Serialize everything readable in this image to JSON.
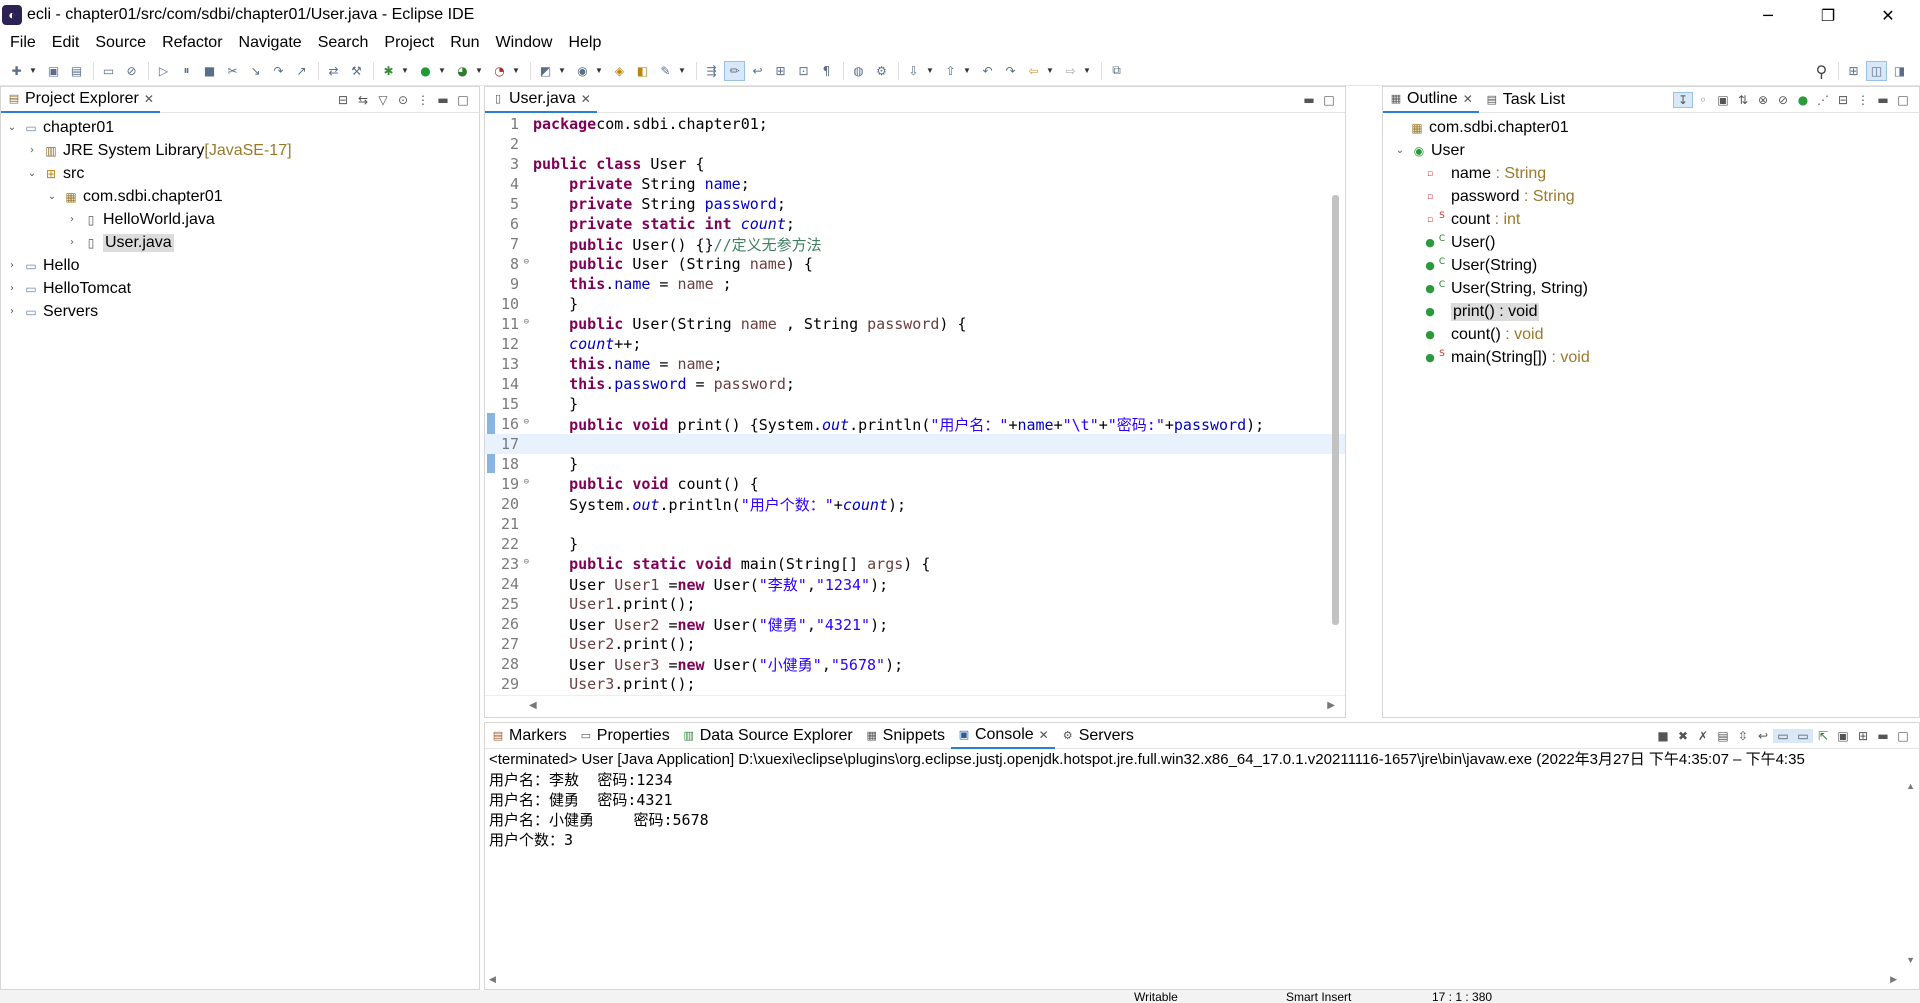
{
  "window": {
    "title": "ecli - chapter01/src/com/sdbi/chapter01/User.java - Eclipse IDE",
    "minimize": "─",
    "maximize": "❐",
    "close": "✕"
  },
  "menu": [
    "File",
    "Edit",
    "Source",
    "Refactor",
    "Navigate",
    "Search",
    "Project",
    "Run",
    "Window",
    "Help"
  ],
  "project_explorer": {
    "tab": "Project Explorer",
    "items": [
      {
        "label": "chapter01",
        "icon": "project-icon",
        "indent": 0,
        "expanded": true
      },
      {
        "label": "JRE System Library",
        "decor": " [JavaSE-17]",
        "icon": "library-icon",
        "indent": 1,
        "expanded": false
      },
      {
        "label": "src",
        "icon": "package-folder-icon",
        "indent": 1,
        "expanded": true
      },
      {
        "label": "com.sdbi.chapter01",
        "icon": "package-icon",
        "indent": 2,
        "expanded": true
      },
      {
        "label": "HelloWorld.java",
        "icon": "java-file-icon",
        "indent": 3,
        "expanded": false
      },
      {
        "label": "User.java",
        "icon": "java-file-icon",
        "indent": 3,
        "expanded": false,
        "selected": true
      },
      {
        "label": "Hello",
        "icon": "project-icon",
        "indent": 0,
        "expanded": false
      },
      {
        "label": "HelloTomcat",
        "icon": "project-icon",
        "indent": 0,
        "expanded": false
      },
      {
        "label": "Servers",
        "icon": "project-icon",
        "indent": 0,
        "expanded": false
      }
    ]
  },
  "editor": {
    "tab": "User.java",
    "current_line": 17,
    "lines": [
      {
        "n": "1",
        "t": [
          [
            "kw",
            "package"
          ],
          [
            "",
            "com.sdbi.chapter01;"
          ]
        ]
      },
      {
        "n": "2",
        "t": []
      },
      {
        "n": "3",
        "t": [
          [
            "kw",
            "public class"
          ],
          [
            "",
            " User {"
          ]
        ]
      },
      {
        "n": "4",
        "t": [
          [
            "",
            "    "
          ],
          [
            "kw",
            "private"
          ],
          [
            "",
            " String "
          ],
          [
            "fld",
            "name"
          ],
          [
            "",
            ";"
          ]
        ]
      },
      {
        "n": "5",
        "t": [
          [
            "",
            "    "
          ],
          [
            "kw",
            "private"
          ],
          [
            "",
            " String "
          ],
          [
            "fld",
            "password"
          ],
          [
            "",
            ";"
          ]
        ]
      },
      {
        "n": "6",
        "t": [
          [
            "",
            "    "
          ],
          [
            "kw",
            "private static int"
          ],
          [
            "",
            " "
          ],
          [
            "sf",
            "count"
          ],
          [
            "",
            ";"
          ]
        ]
      },
      {
        "n": "7",
        "t": [
          [
            "",
            "    "
          ],
          [
            "kw",
            "public"
          ],
          [
            "",
            " User() {}"
          ],
          [
            "cmt",
            "//定义无参方法"
          ]
        ]
      },
      {
        "n": "8",
        "fold": true,
        "t": [
          [
            "",
            "    "
          ],
          [
            "kw",
            "public"
          ],
          [
            "",
            " User (String "
          ],
          [
            "var",
            "name"
          ],
          [
            "",
            ") {"
          ]
        ]
      },
      {
        "n": "9",
        "t": [
          [
            "",
            "    "
          ],
          [
            "kw",
            "this"
          ],
          [
            "",
            "."
          ],
          [
            "fld",
            "name"
          ],
          [
            "",
            " = "
          ],
          [
            "var",
            "name"
          ],
          [
            "",
            " ;"
          ]
        ]
      },
      {
        "n": "10",
        "t": [
          [
            "",
            "    }"
          ]
        ]
      },
      {
        "n": "11",
        "fold": true,
        "t": [
          [
            "",
            "    "
          ],
          [
            "kw",
            "public"
          ],
          [
            "",
            " User(String "
          ],
          [
            "var",
            "name"
          ],
          [
            "",
            " , String "
          ],
          [
            "var",
            "password"
          ],
          [
            "",
            ") {"
          ]
        ]
      },
      {
        "n": "12",
        "t": [
          [
            "",
            "    "
          ],
          [
            "sf",
            "count"
          ],
          [
            "",
            "++;"
          ]
        ]
      },
      {
        "n": "13",
        "t": [
          [
            "",
            "    "
          ],
          [
            "kw",
            "this"
          ],
          [
            "",
            "."
          ],
          [
            "fld",
            "name"
          ],
          [
            "",
            " = "
          ],
          [
            "var",
            "name"
          ],
          [
            "",
            ";"
          ]
        ]
      },
      {
        "n": "14",
        "t": [
          [
            "",
            "    "
          ],
          [
            "kw",
            "this"
          ],
          [
            "",
            "."
          ],
          [
            "fld",
            "password"
          ],
          [
            "",
            " = "
          ],
          [
            "var",
            "password"
          ],
          [
            "",
            ";"
          ]
        ]
      },
      {
        "n": "15",
        "t": [
          [
            "",
            "    }"
          ]
        ]
      },
      {
        "n": "16",
        "fold": true,
        "t": [
          [
            "",
            "    "
          ],
          [
            "kw",
            "public void"
          ],
          [
            "",
            " print() {System."
          ],
          [
            "sf",
            "out"
          ],
          [
            "",
            ".println("
          ],
          [
            "str",
            "\"用户名：\""
          ],
          [
            "",
            "+"
          ],
          [
            "fld",
            "name"
          ],
          [
            "",
            "+"
          ],
          [
            "str",
            "\"\\t\""
          ],
          [
            "",
            "+"
          ],
          [
            "str",
            "\"密码:\""
          ],
          [
            "",
            "+"
          ],
          [
            "fld",
            "password"
          ],
          [
            "",
            ");"
          ]
        ]
      },
      {
        "n": "17",
        "t": []
      },
      {
        "n": "18",
        "t": [
          [
            "",
            "    }"
          ]
        ]
      },
      {
        "n": "19",
        "fold": true,
        "t": [
          [
            "",
            "    "
          ],
          [
            "kw",
            "public void"
          ],
          [
            "",
            " count() {"
          ]
        ]
      },
      {
        "n": "20",
        "t": [
          [
            "",
            "    System."
          ],
          [
            "sf",
            "out"
          ],
          [
            "",
            ".println("
          ],
          [
            "str",
            "\"用户个数：\""
          ],
          [
            "",
            "+"
          ],
          [
            "sf",
            "count"
          ],
          [
            "",
            ");"
          ]
        ]
      },
      {
        "n": "21",
        "t": []
      },
      {
        "n": "22",
        "t": [
          [
            "",
            "    }"
          ]
        ]
      },
      {
        "n": "23",
        "fold": true,
        "t": [
          [
            "",
            "    "
          ],
          [
            "kw",
            "public static void"
          ],
          [
            "",
            " main(String[] "
          ],
          [
            "var",
            "args"
          ],
          [
            "",
            ") {"
          ]
        ]
      },
      {
        "n": "24",
        "t": [
          [
            "",
            "    User "
          ],
          [
            "var",
            "User1"
          ],
          [
            "",
            " ="
          ],
          [
            "kw",
            "new"
          ],
          [
            "",
            " User("
          ],
          [
            "str",
            "\"李敖\""
          ],
          [
            "",
            ","
          ],
          [
            "str",
            "\"1234\""
          ],
          [
            "",
            ");"
          ]
        ]
      },
      {
        "n": "25",
        "t": [
          [
            "",
            "    "
          ],
          [
            "var",
            "User1"
          ],
          [
            "",
            ".print();"
          ]
        ]
      },
      {
        "n": "26",
        "t": [
          [
            "",
            "    User "
          ],
          [
            "var",
            "User2"
          ],
          [
            "",
            " ="
          ],
          [
            "kw",
            "new"
          ],
          [
            "",
            " User("
          ],
          [
            "str",
            "\"健勇\""
          ],
          [
            "",
            ","
          ],
          [
            "str",
            "\"4321\""
          ],
          [
            "",
            ");"
          ]
        ]
      },
      {
        "n": "27",
        "t": [
          [
            "",
            "    "
          ],
          [
            "var",
            "User2"
          ],
          [
            "",
            ".print();"
          ]
        ]
      },
      {
        "n": "28",
        "t": [
          [
            "",
            "    User "
          ],
          [
            "var",
            "User3"
          ],
          [
            "",
            " ="
          ],
          [
            "kw",
            "new"
          ],
          [
            "",
            " User("
          ],
          [
            "str",
            "\"小健勇\""
          ],
          [
            "",
            ","
          ],
          [
            "str",
            "\"5678\""
          ],
          [
            "",
            ");"
          ]
        ]
      },
      {
        "n": "29",
        "t": [
          [
            "",
            "    "
          ],
          [
            "var",
            "User3"
          ],
          [
            "",
            ".print();"
          ]
        ]
      }
    ]
  },
  "outline": {
    "tabs": [
      "Outline",
      "Task List"
    ],
    "package": "com.sdbi.chapter01",
    "class": "User",
    "members": [
      {
        "name": "name",
        "type": " : String",
        "vis": "private",
        "mod": ""
      },
      {
        "name": "password",
        "type": " : String",
        "vis": "private",
        "mod": ""
      },
      {
        "name": "count",
        "type": " : int",
        "vis": "private",
        "mod": "S"
      },
      {
        "name": "User()",
        "type": "",
        "vis": "public",
        "mod": "C"
      },
      {
        "name": "User(String)",
        "type": "",
        "vis": "public",
        "mod": "C"
      },
      {
        "name": "User(String, String)",
        "type": "",
        "vis": "public",
        "mod": "C"
      },
      {
        "name": "print()",
        "type": " : void",
        "vis": "public",
        "mod": "",
        "selected": true
      },
      {
        "name": "count()",
        "type": " : void",
        "vis": "public",
        "mod": ""
      },
      {
        "name": "main(String[])",
        "type": " : void",
        "vis": "public",
        "mod": "S"
      }
    ]
  },
  "bottom": {
    "tabs": [
      {
        "label": "Markers",
        "icon": "markers-icon"
      },
      {
        "label": "Properties",
        "icon": "properties-icon"
      },
      {
        "label": "Data Source Explorer",
        "icon": "data-source-icon"
      },
      {
        "label": "Snippets",
        "icon": "snippets-icon"
      },
      {
        "label": "Console",
        "icon": "console-icon",
        "active": true
      },
      {
        "label": "Servers",
        "icon": "servers-icon"
      }
    ],
    "console_header": "<terminated> User [Java Application] D:\\xuexi\\eclipse\\plugins\\org.eclipse.justj.openjdk.hotspot.jre.full.win32.x86_64_17.0.1.v20211116-1657\\jre\\bin\\javaw.exe  (2022年3月27日 下午4:35:07 – 下午4:35",
    "console_lines": [
      "用户名：李敖\t密码:1234",
      "用户名：健勇\t密码:4321",
      "用户名：小健勇\t密码:5678",
      "用户个数：3"
    ]
  },
  "statusbar": {
    "writable": "Writable",
    "insert": "Smart Insert",
    "position": "17 : 1 : 380"
  }
}
